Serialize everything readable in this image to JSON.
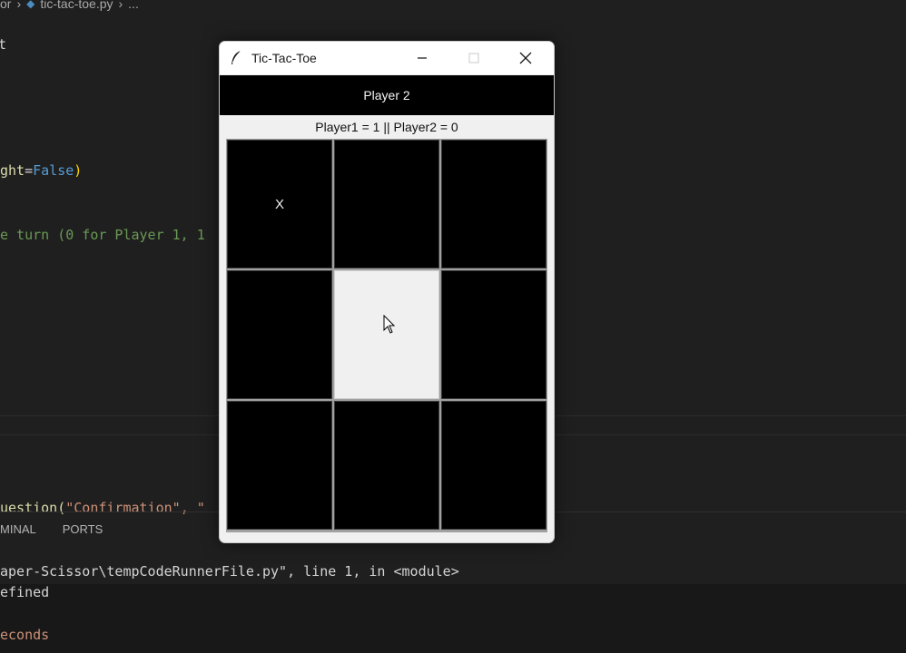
{
  "editor": {
    "breadcrumb": {
      "prefix": "or",
      "file": "tic-tac-toe.py",
      "more": "..."
    },
    "code_lines": [
      {
        "parts": [
          {
            "text": "ght",
            "cls": "c-yellow"
          },
          {
            "text": "=",
            "cls": "c-white"
          },
          {
            "text": "False",
            "cls": "c-blue"
          },
          {
            "text": ")",
            "cls": "c-paren"
          }
        ]
      },
      {
        "parts": [
          {
            "text": "e turn (0 for Player 1, 1",
            "cls": "c-green"
          }
        ]
      },
      {
        "parts": [
          {
            "text": "uestion(",
            "cls": "c-yellow"
          },
          {
            "text": "\"Confirmation\"",
            "cls": "c-orange"
          },
          {
            "text": ", \"",
            "cls": "c-orange"
          }
        ]
      }
    ],
    "stray_char": "t"
  },
  "panel": {
    "tabs": [
      "MINAL",
      "PORTS"
    ],
    "terminal_lines": [
      "aper-Scissor\\tempCodeRunnerFile.py\", line 1, in <module>",
      "efined",
      "",
      "econds"
    ]
  },
  "window": {
    "title": "Tic-Tac-Toe",
    "turn_label": "Player 2",
    "score_label": "Player1 = 1 || Player2 = 0",
    "cells": [
      "X",
      "",
      "",
      "",
      "",
      "",
      "",
      "",
      ""
    ],
    "highlighted_cell": 4
  },
  "colors": {
    "editor_bg": "#1f1f1f",
    "board_cell": "#000000",
    "highlight_cell": "#f0f0f0"
  }
}
